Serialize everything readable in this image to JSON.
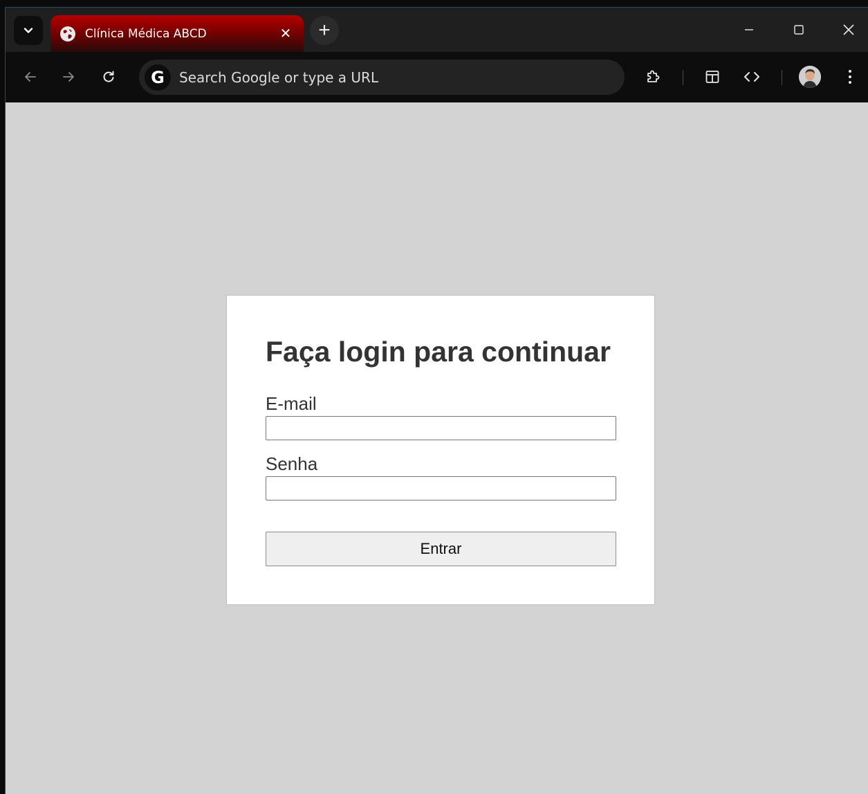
{
  "browser": {
    "tab": {
      "title": "Clínica Médica ABCD",
      "close": "✕"
    },
    "new_tab": "+",
    "omnibox": {
      "placeholder": "Search Google or type a URL",
      "badge": "G"
    },
    "window_controls": {
      "minimize": "—",
      "maximize": "☐",
      "close": "✕"
    }
  },
  "login": {
    "title": "Faça login para continuar",
    "email_label": "E-mail",
    "email_value": "",
    "password_label": "Senha",
    "password_value": "",
    "submit_label": "Entrar"
  },
  "colors": {
    "tab_accent": "#b40000",
    "page_background": "#d3d3d3",
    "card_background": "#ffffff"
  }
}
